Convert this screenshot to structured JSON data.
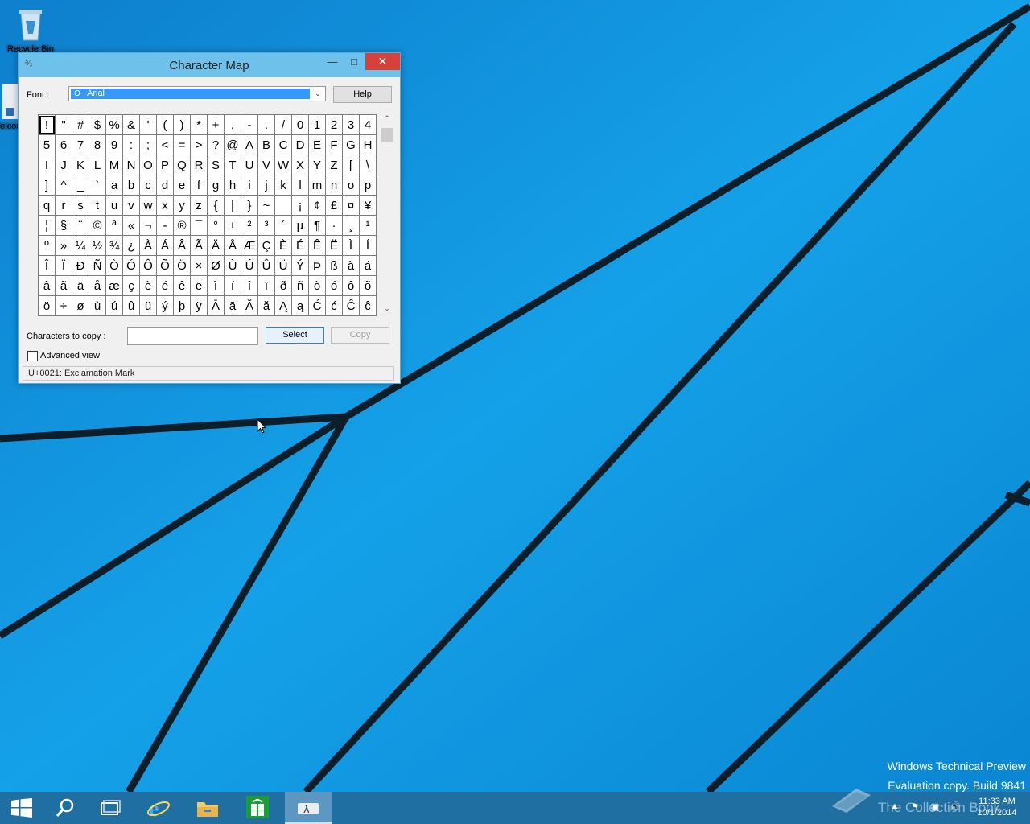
{
  "desktop": {
    "icons": [
      {
        "label": "Recycle Bin"
      },
      {
        "label": "Welcome to Tech Preview"
      }
    ],
    "watermark": {
      "line1": "Windows Technical Preview",
      "line2": "Evaluation copy. Build 9841"
    },
    "collection_book": "The Collection Book"
  },
  "window": {
    "title": "Character Map",
    "font_label": "Font :",
    "font_value": "Arial",
    "help_label": "Help",
    "characters": [
      [
        "!",
        "\"",
        "#",
        "$",
        "%",
        "&",
        "'",
        "(",
        ")",
        "*",
        "+",
        ",",
        "-",
        ".",
        "/",
        "0",
        "1",
        "2",
        "3",
        "4"
      ],
      [
        "5",
        "6",
        "7",
        "8",
        "9",
        ":",
        ";",
        "<",
        "=",
        ">",
        "?",
        "@",
        "A",
        "B",
        "C",
        "D",
        "E",
        "F",
        "G",
        "H"
      ],
      [
        "I",
        "J",
        "K",
        "L",
        "M",
        "N",
        "O",
        "P",
        "Q",
        "R",
        "S",
        "T",
        "U",
        "V",
        "W",
        "X",
        "Y",
        "Z",
        "[",
        "\\"
      ],
      [
        "]",
        "^",
        "_",
        "`",
        "a",
        "b",
        "c",
        "d",
        "e",
        "f",
        "g",
        "h",
        "i",
        "j",
        "k",
        "l",
        "m",
        "n",
        "o",
        "p"
      ],
      [
        "q",
        "r",
        "s",
        "t",
        "u",
        "v",
        "w",
        "x",
        "y",
        "z",
        "{",
        "|",
        "}",
        "~",
        " ",
        "¡",
        "¢",
        "£",
        "¤",
        "¥"
      ],
      [
        "¦",
        "§",
        "¨",
        "©",
        "ª",
        "«",
        "¬",
        "-",
        "®",
        "¯",
        "°",
        "±",
        "²",
        "³",
        "´",
        "µ",
        "¶",
        "·",
        "¸",
        "¹"
      ],
      [
        "º",
        "»",
        "¼",
        "½",
        "¾",
        "¿",
        "À",
        "Á",
        "Â",
        "Ã",
        "Ä",
        "Å",
        "Æ",
        "Ç",
        "È",
        "É",
        "Ê",
        "Ë",
        "Ì",
        "Í"
      ],
      [
        "Î",
        "Ï",
        "Ð",
        "Ñ",
        "Ò",
        "Ó",
        "Ô",
        "Õ",
        "Ö",
        "×",
        "Ø",
        "Ù",
        "Ú",
        "Û",
        "Ü",
        "Ý",
        "Þ",
        "ß",
        "à",
        "á"
      ],
      [
        "â",
        "ã",
        "ä",
        "å",
        "æ",
        "ç",
        "è",
        "é",
        "ê",
        "ë",
        "ì",
        "í",
        "î",
        "ï",
        "ð",
        "ñ",
        "ò",
        "ó",
        "ô",
        "õ"
      ],
      [
        "ö",
        "÷",
        "ø",
        "ù",
        "ú",
        "û",
        "ü",
        "ý",
        "þ",
        "ÿ",
        "Ā",
        "ā",
        "Ă",
        "ă",
        "Ą",
        "ą",
        "Ć",
        "ć",
        "Ĉ",
        "ĉ"
      ]
    ],
    "copy_label": "Characters to copy :",
    "copy_value": "",
    "select_label": "Select",
    "copy_button_label": "Copy",
    "advanced_label": "Advanced view",
    "status": "U+0021: Exclamation Mark"
  },
  "taskbar": {
    "items": [
      "start-icon",
      "search-icon",
      "task-view-icon",
      "internet-explorer-icon",
      "file-explorer-icon",
      "store-icon",
      "character-map-icon"
    ],
    "time": "11:33 AM",
    "date": "10/1/2014"
  }
}
